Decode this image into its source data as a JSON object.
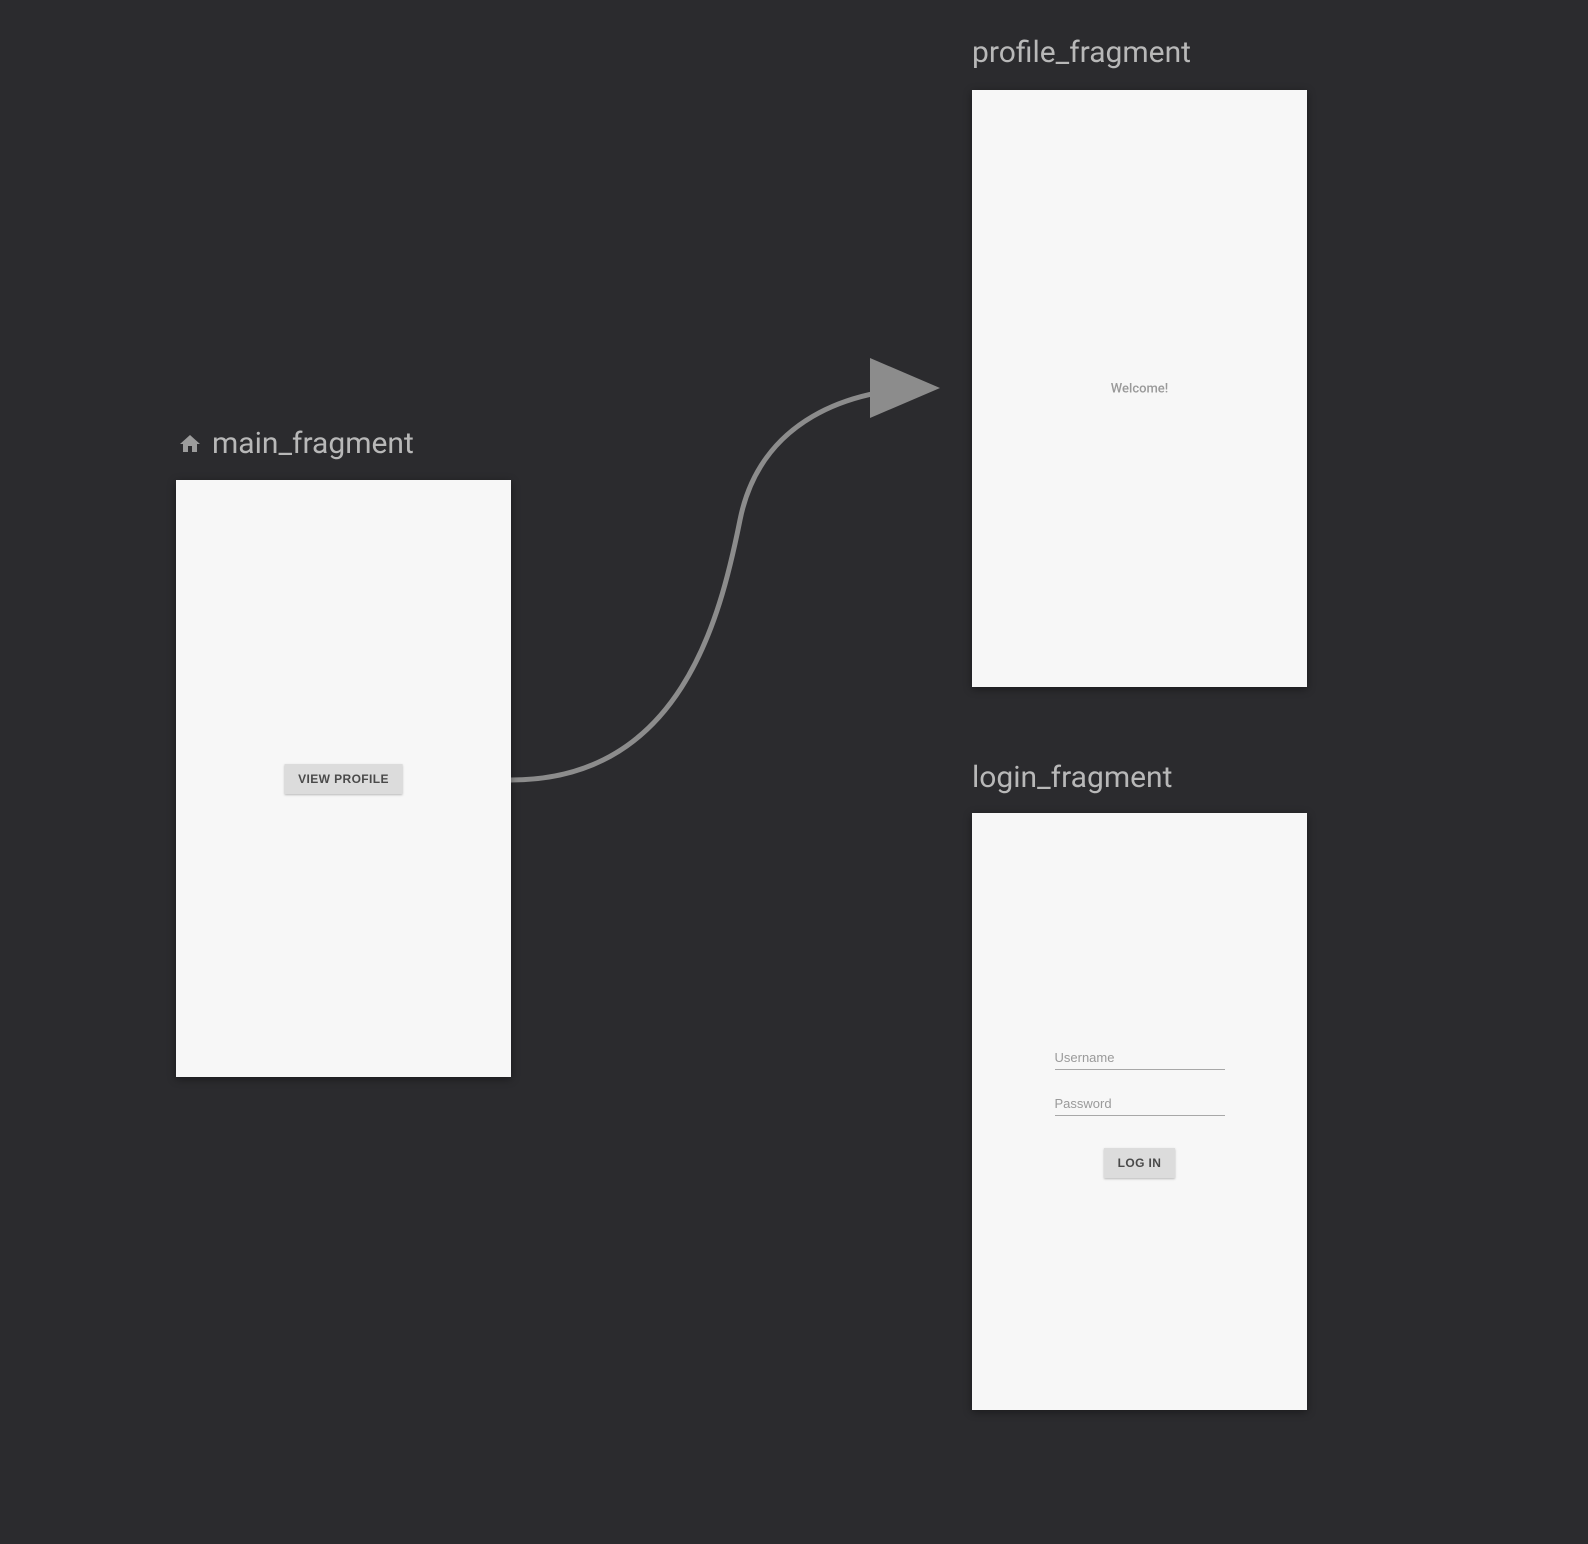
{
  "main": {
    "label": "main_fragment",
    "button_label": "VIEW PROFILE"
  },
  "profile": {
    "label": "profile_fragment",
    "welcome_text": "Welcome!"
  },
  "login": {
    "label": "login_fragment",
    "username_placeholder": "Username",
    "password_placeholder": "Password",
    "button_label": "LOG IN"
  }
}
